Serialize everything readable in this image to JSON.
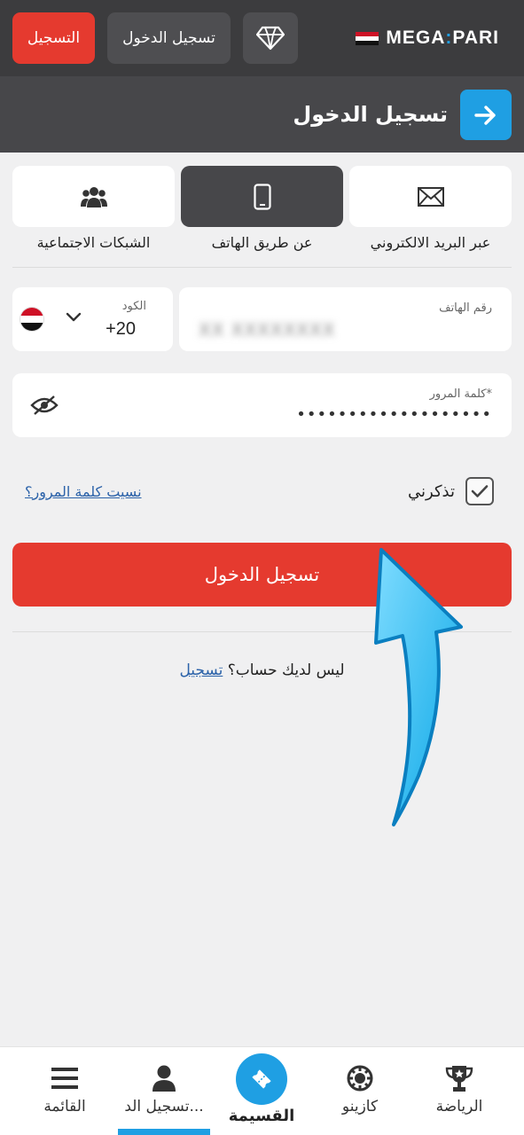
{
  "header": {
    "register_label": "التسجيل",
    "login_label": "تسجيل الدخول",
    "brand_left": "MEGA",
    "brand_right": "PARI",
    "diamond_icon": "diamond-icon"
  },
  "title_bar": {
    "title": "تسجيل الدخول",
    "arrow_icon": "arrow-right-icon"
  },
  "methods": [
    {
      "label": "عبر البريد الالكتروني",
      "icon": "envelope-icon",
      "active": false
    },
    {
      "label": "عن طريق الهاتف",
      "icon": "phone-icon",
      "active": true
    },
    {
      "label": "الشبكات الاجتماعية",
      "icon": "users-icon",
      "active": false
    }
  ],
  "form": {
    "code_label": "الكود",
    "code_value": "+20",
    "phone_label": "رقم الهاتف",
    "phone_value": "XX XXXXXXXX",
    "password_label": "كلمة المرور*",
    "password_value": "•••••••••••••••••••",
    "remember_label": "تذكرني",
    "remember_checked": true,
    "forgot_link": "نسيت كلمة المرور؟",
    "login_button": "تسجيل الدخول",
    "no_account_text": "ليس لديك حساب؟",
    "register_link": "تسجيل"
  },
  "colors": {
    "accent_red": "#e53a2f",
    "accent_blue": "#1f9fe3",
    "header_dark": "#3c3c3e"
  },
  "bottom_nav": {
    "items": [
      {
        "label": "الرياضة",
        "icon": "trophy-icon"
      },
      {
        "label": "كازينو",
        "icon": "casino-chip-icon"
      },
      {
        "label": "القسيمة",
        "icon": "ticket-icon"
      },
      {
        "label": "تسجيل الد...",
        "icon": "user-icon"
      },
      {
        "label": "القائمة",
        "icon": "menu-icon"
      }
    ]
  }
}
